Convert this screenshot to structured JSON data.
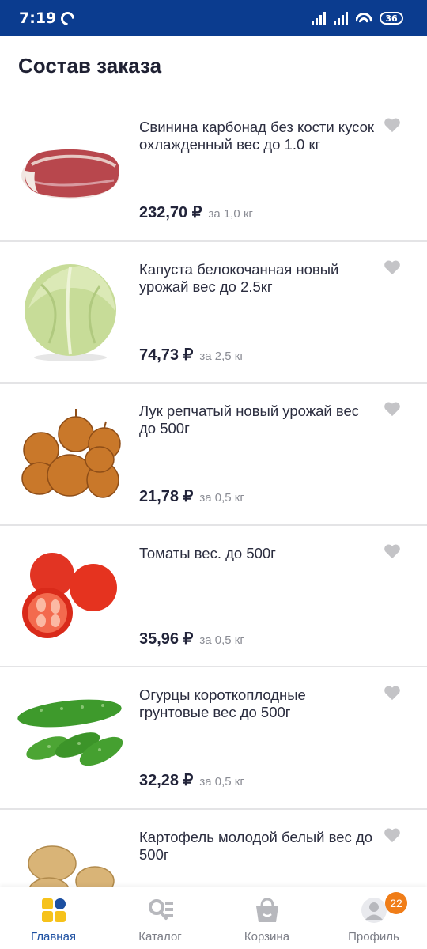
{
  "status_bar": {
    "time": "7:19",
    "battery": "36"
  },
  "page": {
    "title": "Состав заказа"
  },
  "products": [
    {
      "name": "Свинина карбонад без кости кусок охлажденный вес до 1.0 кг",
      "price": "232,70 ₽",
      "unit": "за 1,0 кг",
      "image": "pork-image"
    },
    {
      "name": "Капуста белокочанная новый урожай вес до 2.5кг",
      "price": "74,73 ₽",
      "unit": "за 2,5 кг",
      "image": "cabbage-image"
    },
    {
      "name": "Лук репчатый новый урожай вес до 500г",
      "price": "21,78 ₽",
      "unit": "за 0,5 кг",
      "image": "onion-image"
    },
    {
      "name": "Томаты вес. до 500г",
      "price": "35,96 ₽",
      "unit": "за 0,5 кг",
      "image": "tomato-image"
    },
    {
      "name": "Огурцы короткоплодные грунтовые вес до 500г",
      "price": "32,28 ₽",
      "unit": "за 0,5 кг",
      "image": "cucumber-image"
    },
    {
      "name": "Картофель молодой белый вес до 500г",
      "price": "",
      "unit": "",
      "image": "potato-image"
    }
  ],
  "bottom_nav": {
    "items": [
      {
        "label": "Главная",
        "icon": "home-grid-icon",
        "active": true
      },
      {
        "label": "Каталог",
        "icon": "catalog-icon",
        "active": false
      },
      {
        "label": "Корзина",
        "icon": "basket-icon",
        "active": false
      },
      {
        "label": "Профиль",
        "icon": "profile-icon",
        "active": false,
        "badge": "22"
      }
    ]
  },
  "colors": {
    "status_bar": "#0b3c8f",
    "active_nav": "#1c4fa1",
    "accent_yellow": "#f6c21b",
    "badge": "#f07d18",
    "favorite_icon": "#c4c4c7"
  }
}
